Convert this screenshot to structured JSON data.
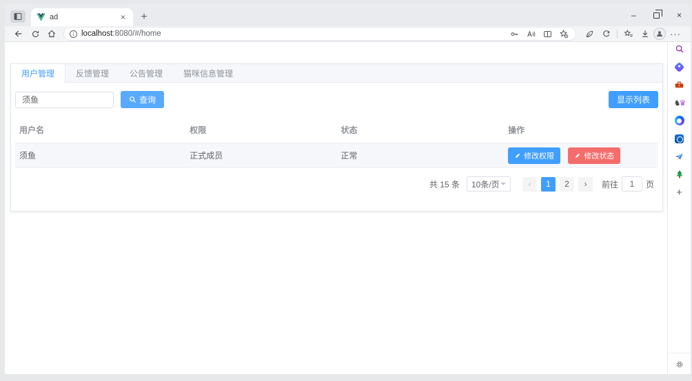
{
  "browser": {
    "tab_title": "ad",
    "tab_close": "×",
    "new_tab_button": "+",
    "url_host": "localhost",
    "url_rest": ":8080/#/home",
    "window_controls": {
      "minimize": "–",
      "close": "×"
    },
    "more_menu": "···"
  },
  "icons": {
    "tab_favicon": "vue-logo",
    "toolbar": [
      "tab-actions",
      "back",
      "refresh",
      "home",
      "site-info"
    ],
    "address_bar_right": [
      "password-key",
      "read-aloud",
      "split-screen",
      "add-favorite"
    ],
    "toolbar_right": [
      "editor-feather",
      "extension-arc",
      "favorites",
      "downloads",
      "profile-avatar",
      "more-menu"
    ],
    "edge_sidebar": [
      "search",
      "shopping-tag",
      "tools",
      "games",
      "copilot",
      "outlook",
      "drop-plane",
      "tree",
      "add",
      "settings-gear"
    ]
  },
  "app": {
    "tabs": [
      {
        "label": "用户管理"
      },
      {
        "label": "反馈管理"
      },
      {
        "label": "公告管理"
      },
      {
        "label": "猫咪信息管理"
      }
    ],
    "search": {
      "keyword_value": "须鱼",
      "query_button": "查询",
      "show_list_button": "显示列表"
    },
    "table": {
      "columns": [
        "用户名",
        "权限",
        "状态",
        "操作"
      ],
      "rows": [
        {
          "username": "须鱼",
          "role": "正式成员",
          "status": "正常",
          "edit_permission_button": "修改权限",
          "edit_status_button": "修改状态"
        }
      ]
    },
    "pagination": {
      "total": "共 15 条",
      "page_size": "10条/页",
      "prev": "‹",
      "next": "›",
      "pages": [
        "1",
        "2"
      ],
      "goto_label": "前往",
      "goto_value": "1",
      "goto_unit": "页"
    }
  },
  "colors": {
    "primary": "#409EFF",
    "primary_light": "#58aaff",
    "danger": "#f56c6c"
  }
}
